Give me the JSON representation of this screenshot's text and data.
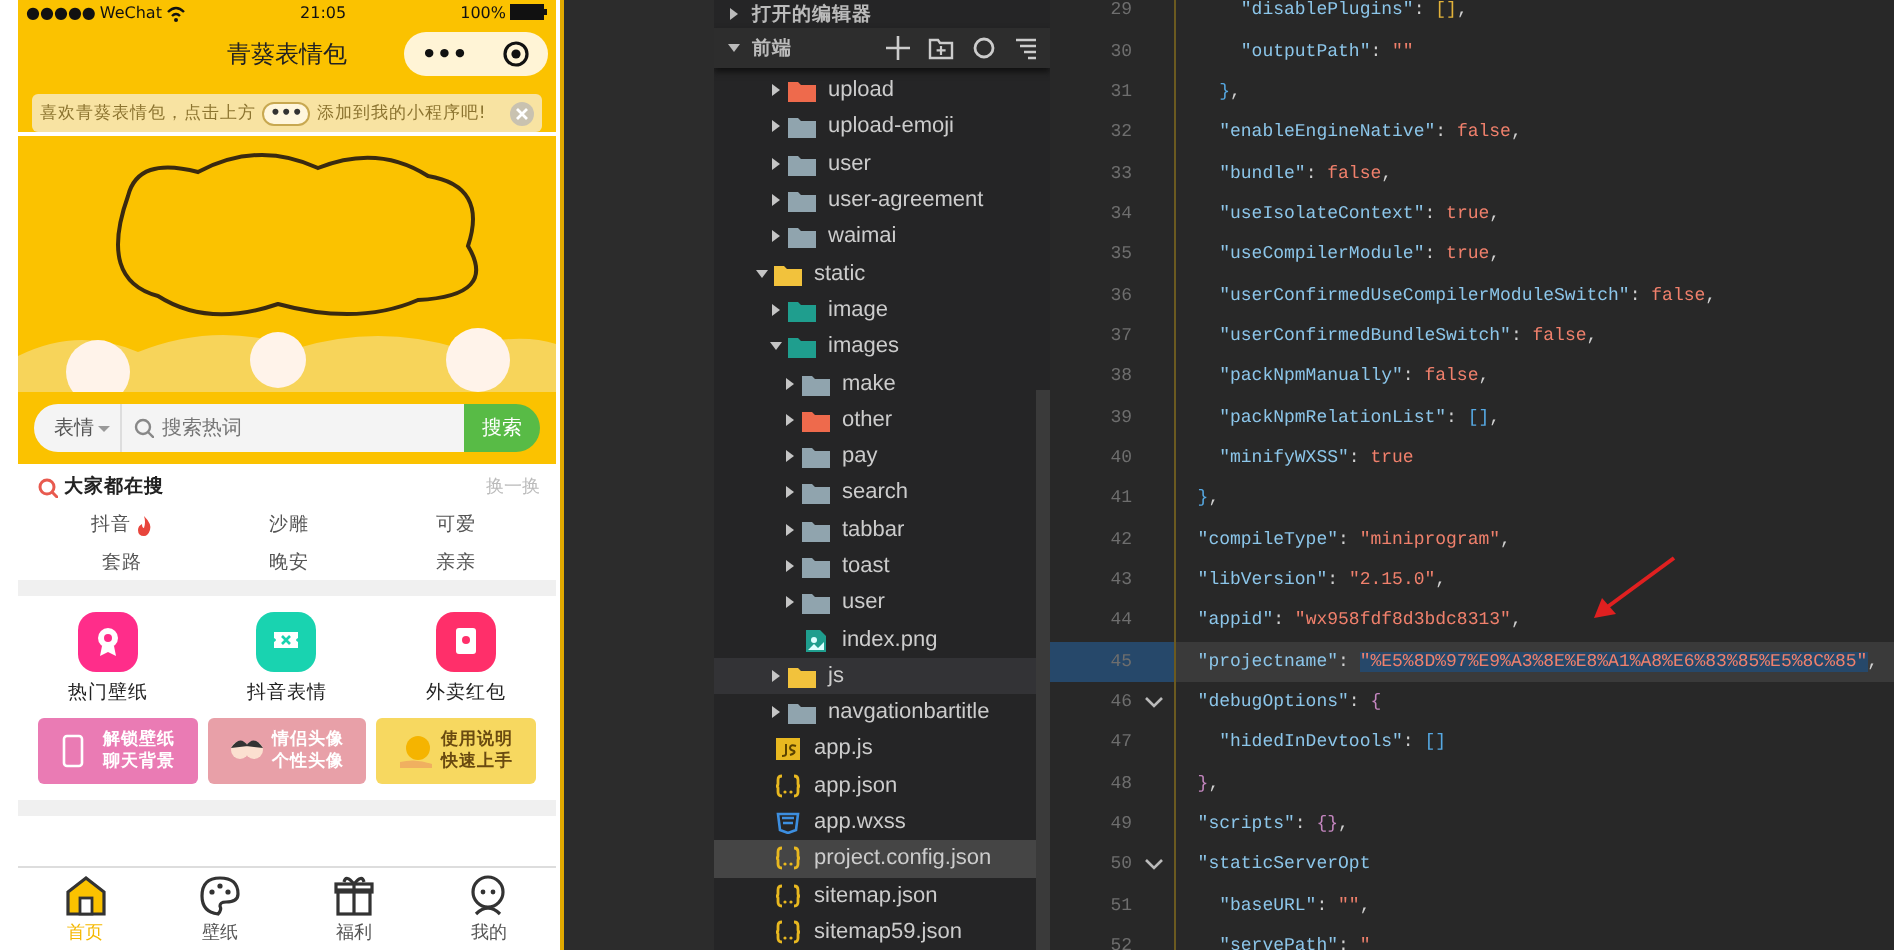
{
  "phone": {
    "status_bar": {
      "signal": "●●●●●",
      "carrier": "WeChat",
      "time": "21:05",
      "battery": "100%"
    },
    "nav_bar": {
      "title": "青葵表情包",
      "capsule_more": "•••"
    },
    "notice": {
      "before": "喜欢青葵表情包，点击上方",
      "badge": "•••",
      "after": "添加到我的小程序吧!"
    },
    "search": {
      "category": "表情",
      "placeholder": "搜索热词",
      "button": "搜索"
    },
    "hot": {
      "title": "大家都在搜",
      "refresh": "换一换",
      "tags": [
        {
          "text": "抖音",
          "hot": true
        },
        {
          "text": "沙雕",
          "hot": false
        },
        {
          "text": "可爱",
          "hot": false
        },
        {
          "text": "套路",
          "hot": false
        },
        {
          "text": "晚安",
          "hot": false
        },
        {
          "text": "亲亲",
          "hot": false
        }
      ]
    },
    "shortcuts": [
      {
        "label": "热门壁纸",
        "color": "#ff2d8a"
      },
      {
        "label": "抖音表情",
        "color": "#19d3b0"
      },
      {
        "label": "外卖红包",
        "color": "#ff2f6a"
      }
    ],
    "promo_cards": [
      {
        "lines": [
          "解锁壁纸",
          "聊天背景"
        ],
        "color": "#ea7bb4"
      },
      {
        "lines": [
          "情侣头像",
          "个性头像"
        ],
        "color": "#e8a0a8"
      },
      {
        "lines": [
          "使用说明",
          "快速上手"
        ],
        "color": "#f7d860"
      }
    ],
    "tab_bar": [
      {
        "label": "首页",
        "selected": true
      },
      {
        "label": "壁纸",
        "selected": false
      },
      {
        "label": "福利",
        "selected": false
      },
      {
        "label": "我的",
        "selected": false
      }
    ]
  },
  "explorer": {
    "sections": [
      {
        "label": "打开的编辑器",
        "expanded": false
      },
      {
        "label": "前端",
        "expanded": true
      }
    ],
    "continued_items": [
      {
        "label": "upload",
        "kind": "folder",
        "color": "#ee6a4c",
        "expanded": false,
        "selected": false,
        "hovered": false
      },
      {
        "label": "upload-emoji",
        "kind": "folder",
        "color": "#90a4ae",
        "expanded": false,
        "selected": false,
        "hovered": false
      },
      {
        "label": "user",
        "kind": "folder",
        "color": "#90a4ae",
        "expanded": false,
        "selected": false,
        "hovered": false
      },
      {
        "label": "user-agreement",
        "kind": "folder",
        "color": "#90a4ae",
        "expanded": false,
        "selected": false,
        "hovered": false
      },
      {
        "label": "waimai",
        "kind": "folder",
        "color": "#90a4ae",
        "expanded": false,
        "selected": false,
        "hovered": false
      }
    ],
    "items": [
      {
        "label": "static",
        "kind": "folder",
        "color": "#f2c23c",
        "expanded": true,
        "selected": false,
        "hovered": false,
        "children": [
          {
            "label": "image",
            "kind": "folder",
            "color": "#1f9e8e",
            "expanded": false,
            "selected": false,
            "hovered": false
          },
          {
            "label": "images",
            "kind": "folder",
            "color": "#1f9e8e",
            "expanded": true,
            "selected": false,
            "hovered": false,
            "children": [
              {
                "label": "make",
                "kind": "folder",
                "color": "#90a4ae",
                "expanded": false,
                "selected": false,
                "hovered": false
              },
              {
                "label": "other",
                "kind": "folder",
                "color": "#ee6a4c",
                "expanded": false,
                "selected": false,
                "hovered": false
              },
              {
                "label": "pay",
                "kind": "folder",
                "color": "#90a4ae",
                "expanded": false,
                "selected": false,
                "hovered": false
              },
              {
                "label": "search",
                "kind": "folder",
                "color": "#90a4ae",
                "expanded": false,
                "selected": false,
                "hovered": false
              },
              {
                "label": "tabbar",
                "kind": "folder",
                "color": "#90a4ae",
                "expanded": false,
                "selected": false,
                "hovered": false
              },
              {
                "label": "toast",
                "kind": "folder",
                "color": "#90a4ae",
                "expanded": false,
                "selected": false,
                "hovered": false
              },
              {
                "label": "user",
                "kind": "folder",
                "color": "#90a4ae",
                "expanded": false,
                "selected": false,
                "hovered": false
              },
              {
                "label": "index.png",
                "kind": "image-file",
                "color": "#1f9e8e",
                "selected": false,
                "hovered": false
              }
            ]
          },
          {
            "label": "js",
            "kind": "folder",
            "color": "#f2c23c",
            "expanded": false,
            "selected": false,
            "hovered": true
          },
          {
            "label": "navgationbartitle",
            "kind": "folder",
            "color": "#90a4ae",
            "expanded": false,
            "selected": false,
            "hovered": false
          }
        ]
      },
      {
        "label": "app.js",
        "kind": "js-file",
        "color": "#e8b820",
        "selected": false,
        "hovered": false
      },
      {
        "label": "app.json",
        "kind": "json-file",
        "color": "#e8b820",
        "selected": false,
        "hovered": false
      },
      {
        "label": "app.wxss",
        "kind": "style-file",
        "color": "#3d8fe0",
        "selected": false,
        "hovered": false
      },
      {
        "label": "project.config.json",
        "kind": "json-file",
        "color": "#e8b820",
        "selected": true,
        "hovered": false
      },
      {
        "label": "sitemap.json",
        "kind": "json-file",
        "color": "#e8b820",
        "selected": false,
        "hovered": false
      },
      {
        "label": "sitemap59.json",
        "kind": "json-file",
        "color": "#e8b820",
        "selected": false,
        "hovered": false
      }
    ]
  },
  "editor": {
    "lines": [
      {
        "number": "29",
        "foldable": false,
        "selected": false,
        "parts": [
          {
            "kind": "key",
            "text": "      \"disablePlugins\""
          },
          {
            "kind": "punct",
            "text": ": "
          },
          {
            "kind": "bracket-gold",
            "text": "[]"
          },
          {
            "kind": "punct",
            "text": ","
          }
        ]
      },
      {
        "number": "30",
        "foldable": false,
        "selected": false,
        "parts": [
          {
            "kind": "key",
            "text": "      \"outputPath\""
          },
          {
            "kind": "punct",
            "text": ": "
          },
          {
            "kind": "literal",
            "text": "\"\""
          }
        ]
      },
      {
        "number": "31",
        "foldable": false,
        "selected": false,
        "parts": [
          {
            "kind": "bracket-blue",
            "text": "    }"
          },
          {
            "kind": "punct",
            "text": ","
          }
        ]
      },
      {
        "number": "32",
        "foldable": false,
        "selected": false,
        "parts": [
          {
            "kind": "key",
            "text": "    \"enableEngineNative\""
          },
          {
            "kind": "punct",
            "text": ": "
          },
          {
            "kind": "literal",
            "text": "false"
          },
          {
            "kind": "punct",
            "text": ","
          }
        ]
      },
      {
        "number": "33",
        "foldable": false,
        "selected": false,
        "parts": [
          {
            "kind": "key",
            "text": "    \"bundle\""
          },
          {
            "kind": "punct",
            "text": ": "
          },
          {
            "kind": "literal",
            "text": "false"
          },
          {
            "kind": "punct",
            "text": ","
          }
        ]
      },
      {
        "number": "34",
        "foldable": false,
        "selected": false,
        "parts": [
          {
            "kind": "key",
            "text": "    \"useIsolateContext\""
          },
          {
            "kind": "punct",
            "text": ": "
          },
          {
            "kind": "literal",
            "text": "true"
          },
          {
            "kind": "punct",
            "text": ","
          }
        ]
      },
      {
        "number": "35",
        "foldable": false,
        "selected": false,
        "parts": [
          {
            "kind": "key",
            "text": "    \"useCompilerModule\""
          },
          {
            "kind": "punct",
            "text": ": "
          },
          {
            "kind": "literal",
            "text": "true"
          },
          {
            "kind": "punct",
            "text": ","
          }
        ]
      },
      {
        "number": "36",
        "foldable": false,
        "selected": false,
        "parts": [
          {
            "kind": "key",
            "text": "    \"userConfirmedUseCompilerModuleSwitch\""
          },
          {
            "kind": "punct",
            "text": ": "
          },
          {
            "kind": "literal",
            "text": "false"
          },
          {
            "kind": "punct",
            "text": ","
          }
        ]
      },
      {
        "number": "37",
        "foldable": false,
        "selected": false,
        "parts": [
          {
            "kind": "key",
            "text": "    \"userConfirmedBundleSwitch\""
          },
          {
            "kind": "punct",
            "text": ": "
          },
          {
            "kind": "literal",
            "text": "false"
          },
          {
            "kind": "punct",
            "text": ","
          }
        ]
      },
      {
        "number": "38",
        "foldable": false,
        "selected": false,
        "parts": [
          {
            "kind": "key",
            "text": "    \"packNpmManually\""
          },
          {
            "kind": "punct",
            "text": ": "
          },
          {
            "kind": "literal",
            "text": "false"
          },
          {
            "kind": "punct",
            "text": ","
          }
        ]
      },
      {
        "number": "39",
        "foldable": false,
        "selected": false,
        "parts": [
          {
            "kind": "key",
            "text": "    \"packNpmRelationList\""
          },
          {
            "kind": "punct",
            "text": ": "
          },
          {
            "kind": "bracket-blue",
            "text": "[]"
          },
          {
            "kind": "punct",
            "text": ","
          }
        ]
      },
      {
        "number": "40",
        "foldable": false,
        "selected": false,
        "parts": [
          {
            "kind": "key",
            "text": "    \"minifyWXSS\""
          },
          {
            "kind": "punct",
            "text": ": "
          },
          {
            "kind": "literal",
            "text": "true"
          }
        ]
      },
      {
        "number": "41",
        "foldable": false,
        "selected": false,
        "parts": [
          {
            "kind": "bracket-blue",
            "text": "  }"
          },
          {
            "kind": "punct",
            "text": ","
          }
        ]
      },
      {
        "number": "42",
        "foldable": false,
        "selected": false,
        "parts": [
          {
            "kind": "key",
            "text": "  \"compileType\""
          },
          {
            "kind": "punct",
            "text": ": "
          },
          {
            "kind": "literal",
            "text": "\"miniprogram\""
          },
          {
            "kind": "punct",
            "text": ","
          }
        ]
      },
      {
        "number": "43",
        "foldable": false,
        "selected": false,
        "parts": [
          {
            "kind": "key",
            "text": "  \"libVersion\""
          },
          {
            "kind": "punct",
            "text": ": "
          },
          {
            "kind": "literal",
            "text": "\"2.15.0\""
          },
          {
            "kind": "punct",
            "text": ","
          }
        ]
      },
      {
        "number": "44",
        "foldable": false,
        "selected": false,
        "parts": [
          {
            "kind": "key",
            "text": "  \"appid\""
          },
          {
            "kind": "punct",
            "text": ": "
          },
          {
            "kind": "literal",
            "text": "\"wx958fdf8d3bdc8313\""
          },
          {
            "kind": "punct",
            "text": ","
          }
        ]
      },
      {
        "number": "45",
        "foldable": false,
        "selected": true,
        "parts": [
          {
            "kind": "key",
            "text": "  \"projectname\""
          },
          {
            "kind": "punct",
            "text": ": "
          },
          {
            "kind": "selection",
            "text": "\"%E5%8D%97%E9%A3%8E%E8%A1%A8%E6%83%85%E5%8C%85\""
          },
          {
            "kind": "punct",
            "text": ","
          }
        ]
      },
      {
        "number": "46",
        "foldable": true,
        "selected": false,
        "parts": [
          {
            "kind": "key",
            "text": "  \"debugOptions\""
          },
          {
            "kind": "punct",
            "text": ": "
          },
          {
            "kind": "bracket-purple",
            "text": "{"
          }
        ]
      },
      {
        "number": "47",
        "foldable": false,
        "selected": false,
        "parts": [
          {
            "kind": "key",
            "text": "    \"hidedInDevtools\""
          },
          {
            "kind": "punct",
            "text": ": "
          },
          {
            "kind": "bracket-blue",
            "text": "[]"
          }
        ]
      },
      {
        "number": "48",
        "foldable": false,
        "selected": false,
        "parts": [
          {
            "kind": "bracket-purple",
            "text": "  }"
          },
          {
            "kind": "punct",
            "text": ","
          }
        ]
      },
      {
        "number": "49",
        "foldable": false,
        "selected": false,
        "parts": [
          {
            "kind": "key",
            "text": "  \"scripts\""
          },
          {
            "kind": "punct",
            "text": ": "
          },
          {
            "kind": "bracket-purple",
            "text": "{}"
          },
          {
            "kind": "punct",
            "text": ","
          }
        ]
      },
      {
        "number": "50",
        "foldable": true,
        "selected": false,
        "parts": [
          {
            "kind": "key",
            "text": "  \"staticServerOpt"
          }
        ]
      },
      {
        "number": "51",
        "foldable": false,
        "selected": false,
        "parts": [
          {
            "kind": "key",
            "text": "    \"baseURL\""
          },
          {
            "kind": "punct",
            "text": ": "
          },
          {
            "kind": "literal",
            "text": "\"\""
          },
          {
            "kind": "punct",
            "text": ","
          }
        ]
      },
      {
        "number": "52",
        "foldable": false,
        "selected": false,
        "parts": [
          {
            "kind": "key",
            "text": "    \"servePath\""
          },
          {
            "kind": "punct",
            "text": ": "
          },
          {
            "kind": "literal",
            "text": "\""
          }
        ]
      }
    ]
  }
}
